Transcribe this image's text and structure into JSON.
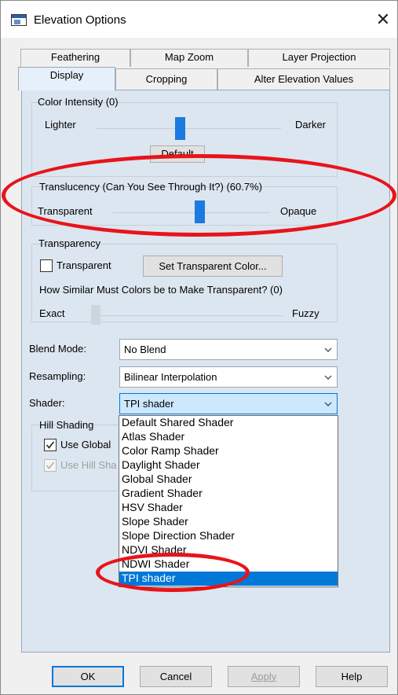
{
  "window": {
    "title": "Elevation Options",
    "close_symbol": "✕"
  },
  "tabs": {
    "row1": [
      "Feathering",
      "Map Zoom",
      "Layer Projection"
    ],
    "row2": [
      "Display",
      "Cropping",
      "Alter Elevation Values"
    ],
    "active": "Display"
  },
  "color_intensity": {
    "group_label": "Color Intensity (0)",
    "left_label": "Lighter",
    "right_label": "Darker",
    "default_button": "Default",
    "value": 0
  },
  "translucency": {
    "group_label": "Translucency (Can You See Through It?) (60.7%)",
    "left_label": "Transparent",
    "right_label": "Opaque",
    "value_percent": 60.7
  },
  "transparency": {
    "group_label": "Transparency",
    "checkbox_label": "Transparent",
    "checked": false,
    "set_color_button": "Set Transparent Color...",
    "similarity_label": "How Similar Must Colors be to Make Transparent? (0)",
    "left_label": "Exact",
    "right_label": "Fuzzy",
    "value": 0
  },
  "blend_mode": {
    "label": "Blend Mode:",
    "value": "No Blend"
  },
  "resampling": {
    "label": "Resampling:",
    "value": "Bilinear Interpolation"
  },
  "shader": {
    "label": "Shader:",
    "value": "TPI shader",
    "options": [
      "Default Shared Shader",
      "Atlas Shader",
      "Color Ramp Shader",
      "Daylight Shader",
      "Global Shader",
      "Gradient Shader",
      "HSV Shader",
      "Slope Shader",
      "Slope Direction Shader",
      "NDVI Shader",
      "NDWI Shader",
      "TPI shader"
    ],
    "selected_index": 11
  },
  "hill_shading": {
    "group_label": "Hill Shading",
    "use_global_label": "Use Global",
    "use_global_checked": true,
    "use_hill_label": "Use Hill Sha",
    "use_hill_checked": true
  },
  "buttons": {
    "ok": "OK",
    "cancel": "Cancel",
    "apply": "Apply",
    "help": "Help"
  },
  "colors": {
    "accent": "#0078d7",
    "slider_thumb": "#1b7adf",
    "panel_bg": "#dce6f0",
    "annotation": "#e8141a"
  }
}
